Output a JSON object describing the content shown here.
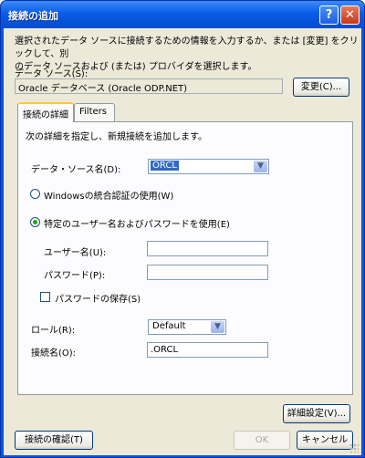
{
  "window": {
    "title": "接続の追加",
    "help_label": "?",
    "close_label": "✕"
  },
  "description": "選択されたデータ ソースに接続するための情報を入力するか、または [変更] をクリックして、別\nのデータ ソースおよび (または) プロバイダを選択します。",
  "data_source": {
    "label": "データ ソース(S):",
    "value": "Oracle データベース (Oracle ODP.NET)",
    "change_button": "変更(C)..."
  },
  "tabs": [
    {
      "label": "接続の詳細",
      "active": true
    },
    {
      "label": "Filters",
      "active": false
    }
  ],
  "details": {
    "instruction": "次の詳細を指定し、新規接続を追加します。",
    "source_name_label": "データ・ソース名(D):",
    "source_name_value": "ORCL",
    "windows_auth_label": "Windowsの統合認証の使用(W)",
    "windows_auth_selected": false,
    "specific_user_label": "特定のユーザー名およびパスワードを使用(E)",
    "specific_user_selected": true,
    "username_label": "ユーザー名(U):",
    "username_value": "",
    "password_label": "パスワード(P):",
    "password_value": "",
    "save_password_label": "パスワードの保存(S)",
    "save_password_checked": false,
    "role_label": "ロール(R):",
    "role_value": "Default",
    "connection_name_label": "接続名(O):",
    "connection_name_value": ".ORCL"
  },
  "buttons": {
    "advanced": "詳細設定(V)...",
    "test": "接続の確認(T)",
    "ok": "OK",
    "cancel": "キャンセル"
  },
  "icons": {
    "dropdown": "chevron-down-icon",
    "close": "close-icon",
    "help": "help-icon"
  }
}
